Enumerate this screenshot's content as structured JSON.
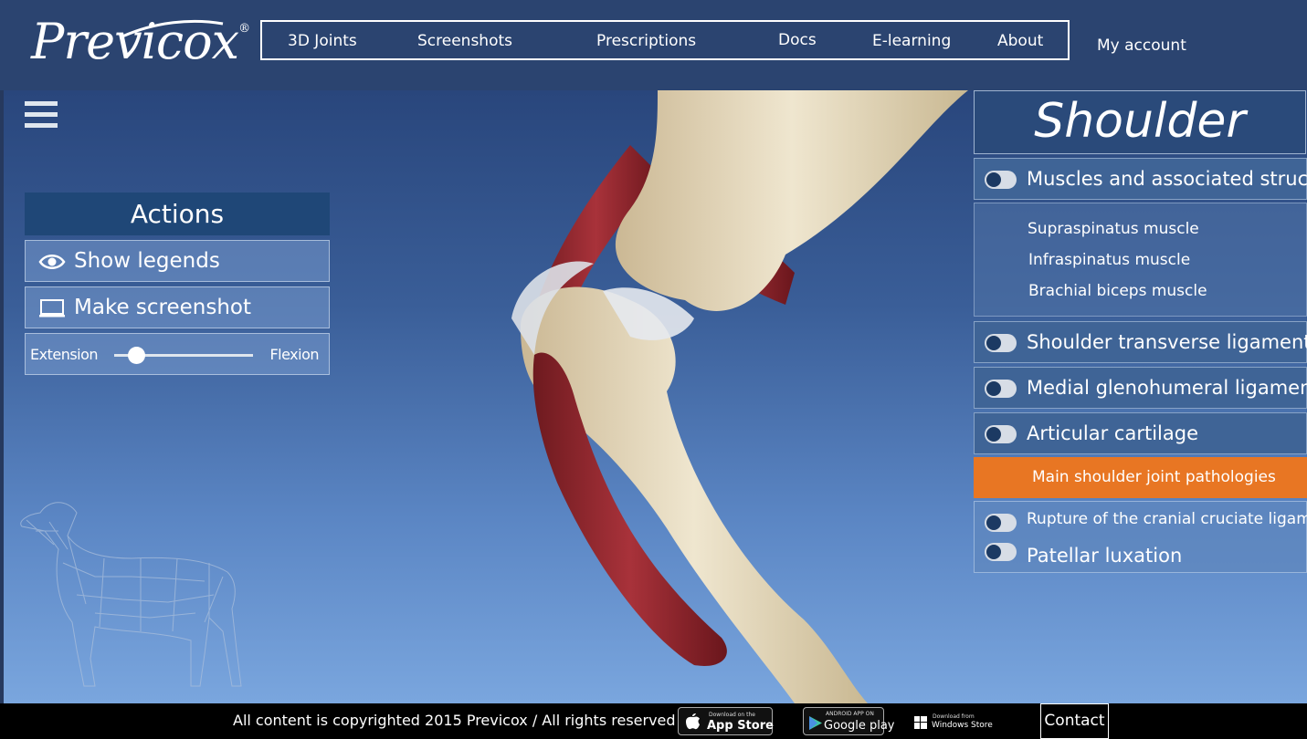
{
  "header": {
    "logo_text": "Previcox",
    "logo_reg": "®",
    "nav": [
      {
        "label": "3D Joints"
      },
      {
        "label": "Screenshots"
      },
      {
        "label": "Prescriptions"
      },
      {
        "label": "Docs"
      },
      {
        "label": "E-learning"
      },
      {
        "label": "About"
      }
    ],
    "my_account": "My account"
  },
  "actions": {
    "title": "Actions",
    "show_legends": "Show legends",
    "make_screenshot": "Make screenshot",
    "slider_left": "Extension",
    "slider_right": "Flexion",
    "slider_value": 0
  },
  "panel": {
    "title": "Shoulder",
    "structures": [
      {
        "label": "Muscles and associated structures"
      },
      {
        "label": "Shoulder transverse ligament"
      },
      {
        "label": "Medial glenohumeral ligament"
      },
      {
        "label": "Articular cartilage"
      }
    ],
    "sub_items": [
      {
        "label": "Supraspinatus muscle"
      },
      {
        "label": "Infraspinatus muscle"
      },
      {
        "label": "Brachial biceps muscle"
      }
    ],
    "pathologies_header": "Main shoulder joint pathologies",
    "pathologies": [
      {
        "label": "Rupture of the cranial cruciate ligament"
      },
      {
        "label": "Patellar luxation"
      }
    ]
  },
  "footer": {
    "copyright": "All content is copyrighted 2015 Previcox / All rights reserved",
    "stores": [
      {
        "small": "Download on the",
        "big": "App Store"
      },
      {
        "small": "ANDROID APP ON",
        "big": "Google play"
      },
      {
        "small": "Download from",
        "big": "Windows Store"
      }
    ],
    "contact": "Contact"
  },
  "colors": {
    "header_bg": "#2b4470",
    "accent_orange": "#e87623",
    "panel_blue": "#3f6496",
    "muscle_red": "#9a2a2f",
    "bone": "#e2d7bd"
  }
}
